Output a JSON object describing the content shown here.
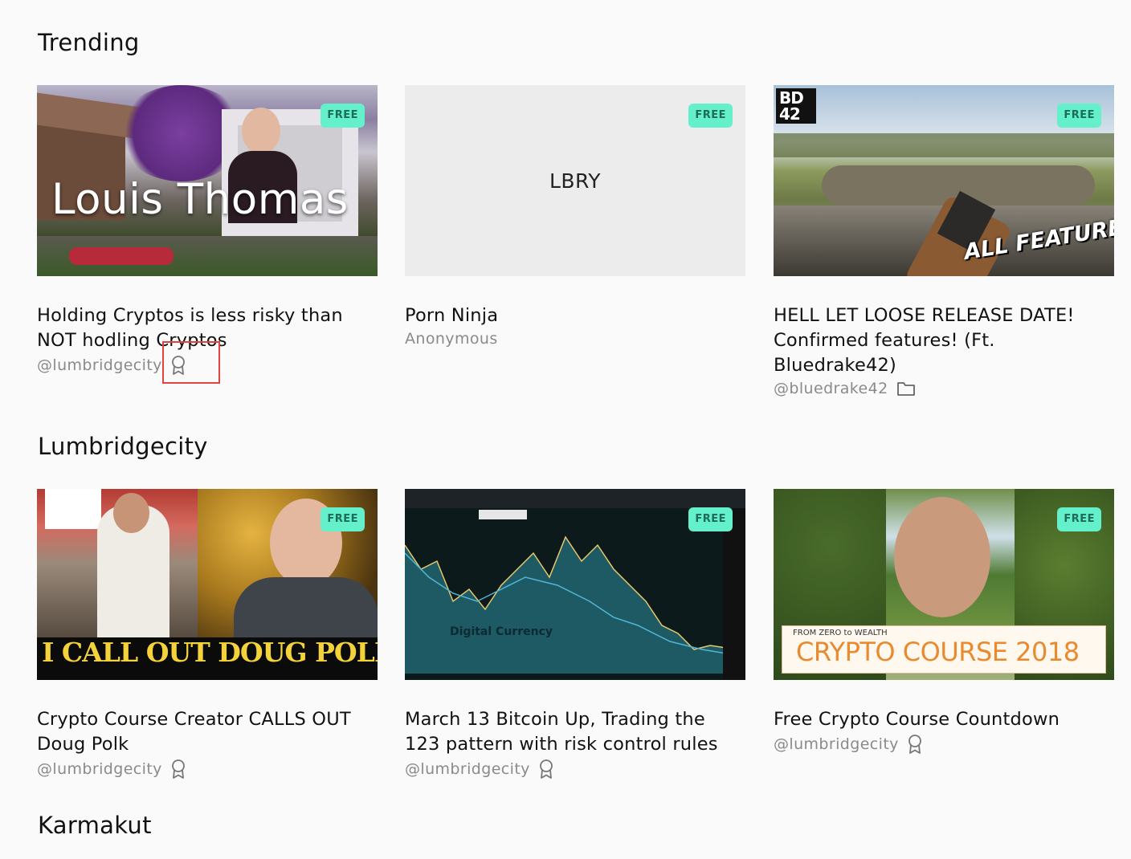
{
  "sections": [
    {
      "title": "Trending",
      "cards": [
        {
          "badge": "FREE",
          "thumb_text": "Louis Thomas",
          "title": "Holding Cryptos is less risky than NOT hodling Cryptos",
          "channel": "@lumbridgecity",
          "channel_icon": "award-icon"
        },
        {
          "badge": "FREE",
          "thumb_text": "LBRY",
          "title": "Porn Ninja",
          "channel": "Anonymous",
          "channel_icon": ""
        },
        {
          "badge": "FREE",
          "thumb_text": "ALL FEATURES!",
          "thumb_logo": "BD 42",
          "title": "HELL LET LOOSE RELEASE DATE! Confirmed features! (Ft. Bluedrake42)",
          "channel": "@bluedrake42",
          "channel_icon": "folder-icon"
        }
      ]
    },
    {
      "title": "Lumbridgecity",
      "cards": [
        {
          "badge": "FREE",
          "thumb_text": "I CALL OUT DOUG POLK",
          "title": "Crypto Course Creator CALLS OUT Doug Polk",
          "channel": "@lumbridgecity",
          "channel_icon": "award-icon"
        },
        {
          "badge": "FREE",
          "thumb_text": "Digital Currency",
          "title": "March 13 Bitcoin Up, Trading the 123 pattern with risk control rules",
          "channel": "@lumbridgecity",
          "channel_icon": "award-icon"
        },
        {
          "badge": "FREE",
          "thumb_subtext": "FROM ZERO to WEALTH",
          "thumb_text": "CRYPTO COURSE 2018",
          "title": "Free Crypto Course Countdown",
          "channel": "@lumbridgecity",
          "channel_icon": "award-icon"
        }
      ]
    },
    {
      "title": "Karmakut",
      "cards": []
    }
  ],
  "colors": {
    "background": "#fafafa",
    "badge_bg": "#63f0cb",
    "badge_text": "#1e6b58",
    "channel_text": "#8a8a8a",
    "highlight": "#e0443e"
  }
}
